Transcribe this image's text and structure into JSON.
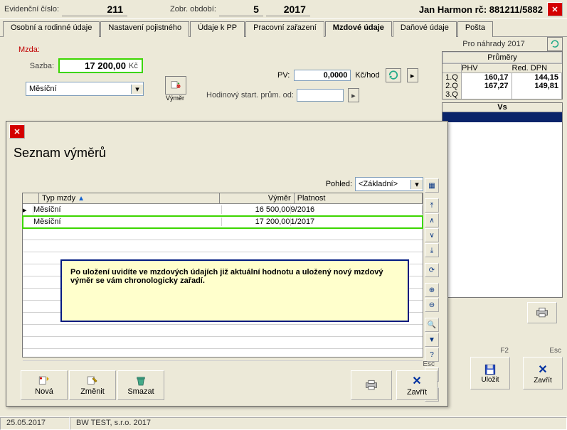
{
  "header": {
    "evid_label": "Evidenční číslo:",
    "evid_value": "211",
    "period_label": "Zobr. období:",
    "period_month": "5",
    "period_year": "2017",
    "person": "Jan Harmon rč: 881211/5882"
  },
  "tabs": [
    "Osobní a rodinné údaje",
    "Nastavení pojistného",
    "Údaje k PP",
    "Pracovní zařazení",
    "Mzdové údaje",
    "Daňové údaje",
    "Pošta"
  ],
  "active_tab_index": 4,
  "mzda": {
    "section_label": "Mzda:",
    "rate_label": "Sazba:",
    "rate_value": "17 200,00",
    "rate_currency": "Kč",
    "type_value": "Měsíční",
    "vymer_button": "Výměr",
    "pv_label": "PV:",
    "pv_value": "0,0000",
    "pv_unit": "Kč/hod",
    "hod_label": "Hodinový start. prům. od:"
  },
  "right": {
    "nahrady_label": "Pro náhrady 2017",
    "prumery_title": "Průměry",
    "col_phv": "PHV",
    "col_red": "Red. DPN",
    "rows": [
      {
        "q": "1.Q",
        "phv": "160,17",
        "red": "144,15"
      },
      {
        "q": "2.Q",
        "phv": "167,27",
        "red": "149,81"
      },
      {
        "q": "3.Q",
        "phv": "",
        "red": ""
      }
    ],
    "vs_title": "Vs"
  },
  "main_buttons": {
    "save_hint": "F2",
    "save_label": "Uložit",
    "close_hint": "Esc",
    "close_label": "Zavřít"
  },
  "dialog": {
    "title": "Seznam výměrů",
    "pohled_label": "Pohled:",
    "pohled_value": "<Základní>",
    "columns": {
      "type": "Typ mzdy",
      "amount": "Výměr",
      "valid": "Platnost"
    },
    "rows": [
      {
        "type": "Měsíční",
        "amount": "16 500,00",
        "valid": "9/2016",
        "highlight": false
      },
      {
        "type": "Měsíční",
        "amount": "17 200,00",
        "valid": "1/2017",
        "highlight": true
      }
    ],
    "note": "Po uložení uvidíte ve mzdových údajích již aktuální hodnotu a uložený nový mzdový výměr se vám chronologicky zařadí.",
    "buttons": {
      "new": "Nová",
      "edit": "Změnit",
      "delete": "Smazat",
      "close_hint": "Esc",
      "close": "Zavřít"
    }
  },
  "status": {
    "date": "25.05.2017",
    "company": "BW TEST, s.r.o.   2017"
  }
}
